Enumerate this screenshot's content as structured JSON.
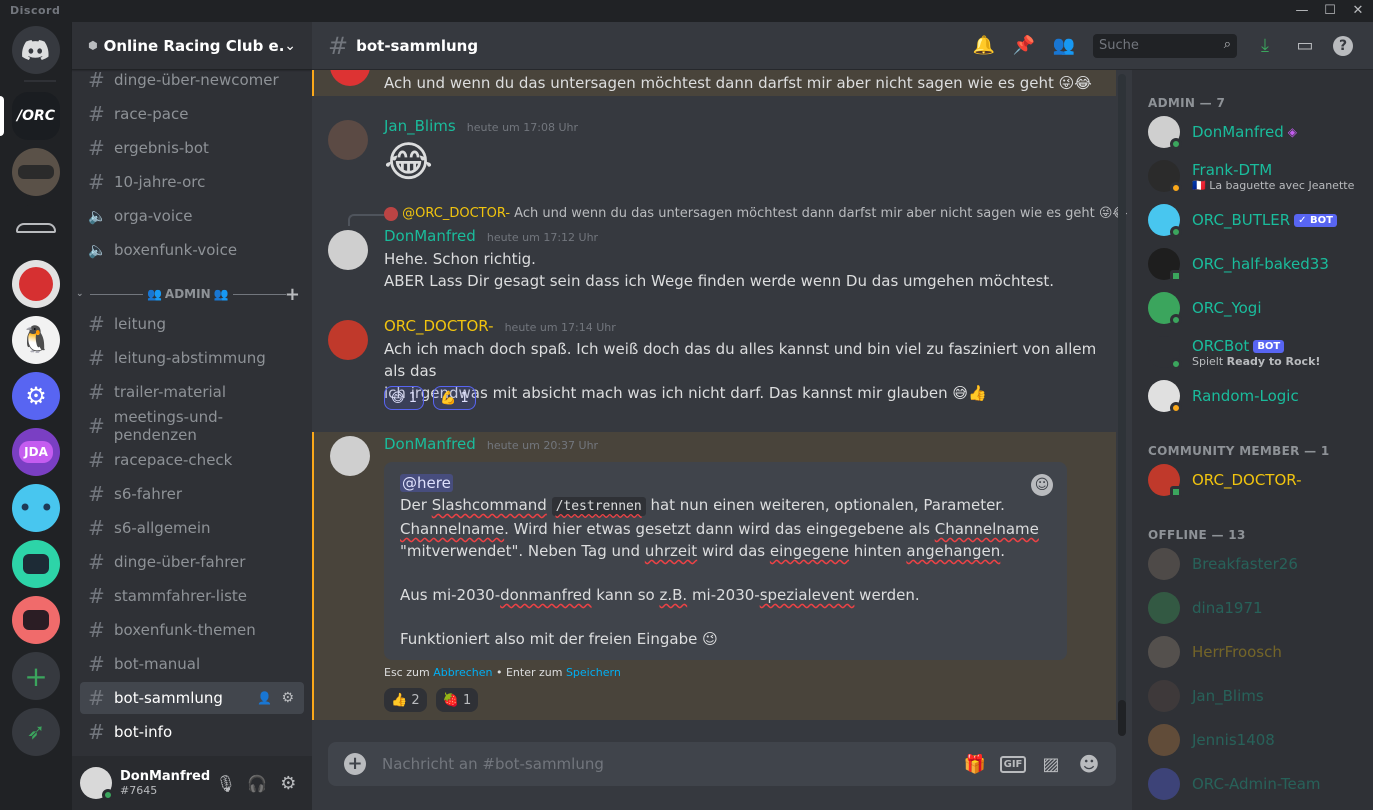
{
  "app": {
    "name": "Discord"
  },
  "server": {
    "name": "Online Racing Club e...."
  },
  "channels_top": [
    {
      "name": "dinge-über-newcomer",
      "type": "text"
    },
    {
      "name": "race-pace",
      "type": "text"
    },
    {
      "name": "ergebnis-bot",
      "type": "text"
    },
    {
      "name": "10-jahre-orc",
      "type": "text"
    },
    {
      "name": "orga-voice",
      "type": "voice"
    },
    {
      "name": "boxenfunk-voice",
      "type": "voice"
    }
  ],
  "category": {
    "label": "ADMIN"
  },
  "channels_admin": [
    {
      "name": "leitung"
    },
    {
      "name": "leitung-abstimmung"
    },
    {
      "name": "trailer-material"
    },
    {
      "name": "meetings-und-pendenzen"
    },
    {
      "name": "racepace-check"
    },
    {
      "name": "s6-fahrer"
    },
    {
      "name": "s6-allgemein"
    },
    {
      "name": "dinge-über-fahrer"
    },
    {
      "name": "stammfahrer-liste"
    },
    {
      "name": "boxenfunk-themen"
    },
    {
      "name": "bot-manual"
    },
    {
      "name": "bot-sammlung"
    },
    {
      "name": "bot-info"
    }
  ],
  "user": {
    "name": "DonManfred",
    "tag": "#7645"
  },
  "channel": {
    "title": "bot-sammlung"
  },
  "search": {
    "placeholder": "Suche"
  },
  "messages": {
    "m0": {
      "text": "Ach und wenn du das untersagen möchtest dann darfst mir aber nicht sagen wie es geht 😜😂"
    },
    "m1": {
      "author": "Jan_Blims",
      "time": "heute um 17:08 Uhr",
      "text": "😂"
    },
    "m2": {
      "reply_author": "@ORC_DOCTOR-",
      "reply_text": "Ach und wenn du das untersagen möchtest dann darfst mir aber nicht sagen wie es geht 😜😂",
      "author": "DonManfred",
      "time": "heute um 17:12 Uhr",
      "line1": "Hehe. Schon richtig.",
      "line2": "ABER Lass Dir gesagt sein dass ich Wege finden werde wenn Du das umgehen möchtest."
    },
    "m3": {
      "author": "ORC_DOCTOR-",
      "time": "heute um 17:14 Uhr",
      "line1": "Ach ich mach doch spaß. Ich weiß doch das du alles kannst und bin viel zu fasziniert von allem als das",
      "line2": "ich irgendwas mit absicht mach was ich nicht darf. Das kannst mir glauben 😅👍",
      "r1_emoji": "😅",
      "r1_count": "1",
      "r2_emoji": "💪",
      "r2_count": "1"
    },
    "m4": {
      "author": "DonManfred",
      "time": "heute um 20:37 Uhr",
      "mention": "@here",
      "l1a": "Der ",
      "l1b": "Slashcommand",
      "l1c": " ",
      "l1code": "/testrennen",
      "l1d": " hat nun einen weiteren, optionalen, Parameter.",
      "l2a": "Channelname",
      "l2b": ". Wird hier etwas gesetzt dann wird das eingegebene als ",
      "l2c": "Channelname",
      "l3a": "\"mitverwendet\". Neben Tag und ",
      "l3b": "uhrzeit",
      "l3c": " wird das ",
      "l3d": "eingegene",
      "l3e": " hinten ",
      "l3f": "angehangen",
      "l3g": ".",
      "l4a": "Aus mi-2030-",
      "l4b": "donmanfred",
      "l4c": " kann so ",
      "l4d": "z.B.",
      "l4e": " mi-2030-",
      "l4f": "spezialevent",
      "l4g": " werden.",
      "l5": "Funktioniert also mit der freien Eingabe 😉",
      "hint_a": "Esc zum ",
      "hint_b": "Abbrechen",
      "hint_c": " • Enter zum ",
      "hint_d": "Speichern",
      "r1_emoji": "👍",
      "r1_count": "2",
      "r2_emoji": "🍓",
      "r2_count": "1"
    }
  },
  "composer": {
    "placeholder": "Nachricht an #bot-sammlung"
  },
  "members": {
    "admin_header": "ADMIN — 7",
    "admin": [
      {
        "name": "DonManfred",
        "sub": "",
        "color": "#1abc9c"
      },
      {
        "name": "Frank-DTM",
        "sub": "🇫🇷 La baguette avec Jeanette",
        "color": "#1abc9c"
      },
      {
        "name": "ORC_BUTLER",
        "sub": "",
        "color": "#1abc9c",
        "bot": "✓ BOT"
      },
      {
        "name": "ORC_half-baked33",
        "sub": "",
        "color": "#1abc9c"
      },
      {
        "name": "ORC_Yogi",
        "sub": "",
        "color": "#1abc9c"
      },
      {
        "name": "ORCBot",
        "sub_a": "Spielt ",
        "sub_b": "Ready to Rock!",
        "color": "#1abc9c",
        "bot": "BOT"
      },
      {
        "name": "Random-Logic",
        "sub": "",
        "color": "#1abc9c"
      }
    ],
    "community_header": "COMMUNITY MEMBER — 1",
    "community": [
      {
        "name": "ORC_DOCTOR-",
        "color": "#f1c40f"
      }
    ],
    "offline_header": "OFFLINE — 13",
    "offline": [
      {
        "name": "Breakfaster26",
        "color": "#1abc9c"
      },
      {
        "name": "dina1971",
        "color": "#1abc9c"
      },
      {
        "name": "HerrFroosch",
        "color": "#f1c40f"
      },
      {
        "name": "Jan_Blims",
        "color": "#1abc9c"
      },
      {
        "name": "Jennis1408",
        "color": "#1abc9c"
      },
      {
        "name": "ORC-Admin-Team",
        "color": "#1abc9c"
      }
    ]
  },
  "colors": {
    "teal": "#1abc9c",
    "gold": "#f1c40f",
    "blurple": "#5865f2",
    "online": "#3ba55d"
  }
}
